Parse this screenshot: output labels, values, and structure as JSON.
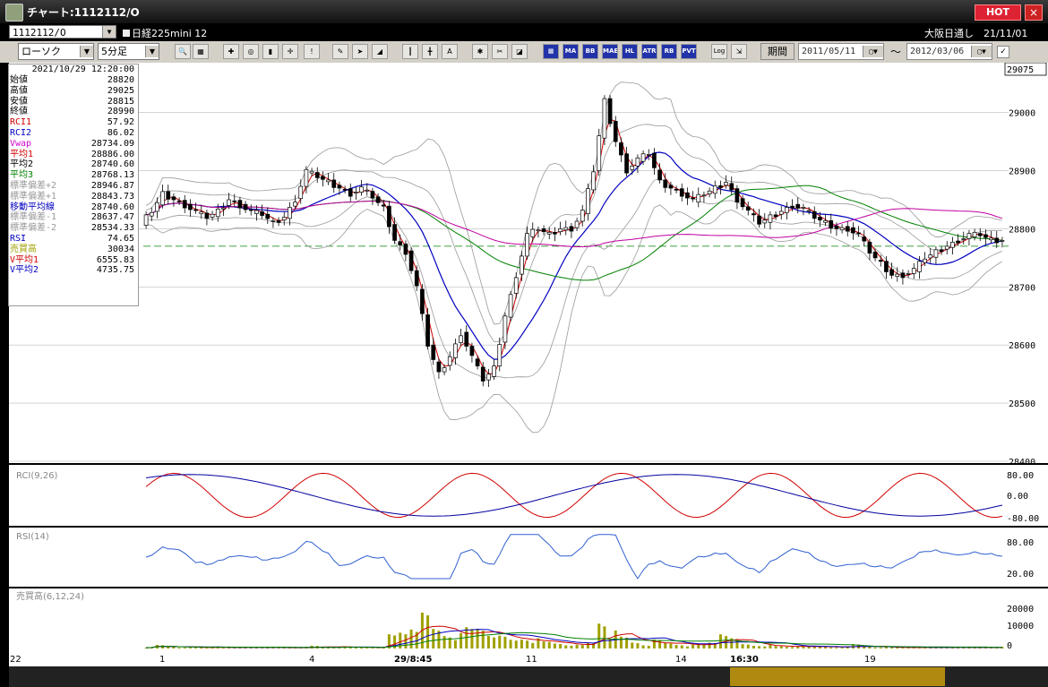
{
  "window": {
    "title": "チャート:1112112/O",
    "hot_label": "HOT",
    "close_label": "×"
  },
  "symbol_bar": {
    "symbol_code": "1112112/O",
    "symbol_name": "日経225mini 12",
    "exchange_info": "大阪日通し　21/11/01"
  },
  "toolbar": {
    "chart_type": "ローソク",
    "interval": "5分足",
    "period_label": "期間",
    "start_date": "2011/05/11",
    "end_date": "2012/03/06",
    "tilde": "～",
    "button_labels": [
      "MA",
      "BB",
      "MAE",
      "HL",
      "ATR",
      "RB",
      "PVT",
      "Log"
    ]
  },
  "info_panel": {
    "datetime": "2021/10/29 12:20:00",
    "rows": [
      {
        "label": "始値",
        "value": "28820",
        "color": "#000000"
      },
      {
        "label": "高値",
        "value": "29025",
        "color": "#000000"
      },
      {
        "label": "安値",
        "value": "28815",
        "color": "#000000"
      },
      {
        "label": "終値",
        "value": "28990",
        "color": "#000000"
      },
      {
        "label": "RCI1",
        "value": "57.92",
        "color": "#d00000"
      },
      {
        "label": "RCI2",
        "value": "86.02",
        "color": "#0000c0"
      },
      {
        "label": "Vwap",
        "value": "28734.09",
        "color": "#d000d0"
      },
      {
        "label": "平均1",
        "value": "28886.00",
        "color": "#d00000"
      },
      {
        "label": "平均2",
        "value": "28740.60",
        "color": "#000000"
      },
      {
        "label": "平均3",
        "value": "28768.13",
        "color": "#008000"
      },
      {
        "label": "標準偏差+2",
        "value": "28946.87",
        "color": "#999999"
      },
      {
        "label": "標準偏差+1",
        "value": "28843.73",
        "color": "#999999"
      },
      {
        "label": "移動平均線",
        "value": "28740.60",
        "color": "#0000c0"
      },
      {
        "label": "標準偏差-1",
        "value": "28637.47",
        "color": "#999999"
      },
      {
        "label": "標準偏差-2",
        "value": "28534.33",
        "color": "#999999"
      },
      {
        "label": "RSI",
        "value": "74.65",
        "color": "#0000c0"
      },
      {
        "label": "売買高",
        "value": "30034",
        "color": "#a0a000"
      },
      {
        "label": "V平均1",
        "value": "6555.83",
        "color": "#d00000"
      },
      {
        "label": "V平均2",
        "value": "4735.75",
        "color": "#0000c0"
      }
    ]
  },
  "price_axis": {
    "current_price": "29075",
    "ticks": [
      "29000",
      "28900",
      "28800",
      "28700",
      "28600",
      "28500",
      "28400"
    ]
  },
  "panels": {
    "rci": {
      "label": "RCI(9,26)",
      "ticks": [
        "80.00",
        "0.00",
        "-80.00"
      ]
    },
    "rsi": {
      "label": "RSI(14)",
      "ticks": [
        "80.00",
        "20.00"
      ]
    },
    "volume": {
      "label": "売買高(6,12,24)",
      "ticks": [
        "20000",
        "10000",
        "0"
      ]
    }
  },
  "time_axis": {
    "labels": [
      "22",
      "1",
      "4",
      "29/8:45",
      "11",
      "14",
      "16:30",
      "19"
    ]
  },
  "chart_data": {
    "type": "candlestick",
    "ylim": [
      28400,
      29075
    ],
    "price_path": [
      28810,
      28830,
      28860,
      28850,
      28840,
      28830,
      28820,
      28830,
      28850,
      28840,
      28830,
      28825,
      28810,
      28820,
      28850,
      28900,
      28890,
      28880,
      28870,
      28860,
      28870,
      28855,
      28835,
      28780,
      28760,
      28700,
      28600,
      28550,
      28580,
      28620,
      28580,
      28540,
      28560,
      28650,
      28720,
      28790,
      28800,
      28790,
      28800,
      28800,
      28830,
      28900,
      29020,
      28950,
      28900,
      28920,
      28930,
      28880,
      28870,
      28860,
      28850,
      28860,
      28870,
      28880,
      28850,
      28830,
      28810,
      28820,
      28830,
      28840,
      28835,
      28820,
      28810,
      28800,
      28800,
      28790,
      28760,
      28740,
      28720,
      28720,
      28730,
      28750,
      28760,
      28770,
      28780,
      28790,
      28790,
      28780,
      28780
    ],
    "volume_path": [
      500,
      1500,
      800,
      600,
      400,
      500,
      700,
      600,
      400,
      900,
      600,
      500,
      400,
      300,
      600,
      1200,
      700,
      600,
      800,
      500,
      400,
      300,
      6000,
      8000,
      12000,
      14000,
      9000,
      7000,
      6000,
      9000,
      10000,
      8000,
      5000,
      4000,
      5000,
      4000,
      3000,
      2500,
      2000,
      1500,
      2500,
      14000,
      7000,
      5000,
      3000,
      2000,
      3500,
      2500,
      2000,
      1500,
      2000,
      3000,
      9000,
      4000,
      2000,
      1500,
      1500,
      1000,
      800,
      1200,
      1000,
      800,
      600,
      700,
      1800,
      900,
      700,
      500,
      400,
      600,
      500,
      700,
      500,
      800,
      600,
      500,
      400,
      600,
      500
    ]
  }
}
